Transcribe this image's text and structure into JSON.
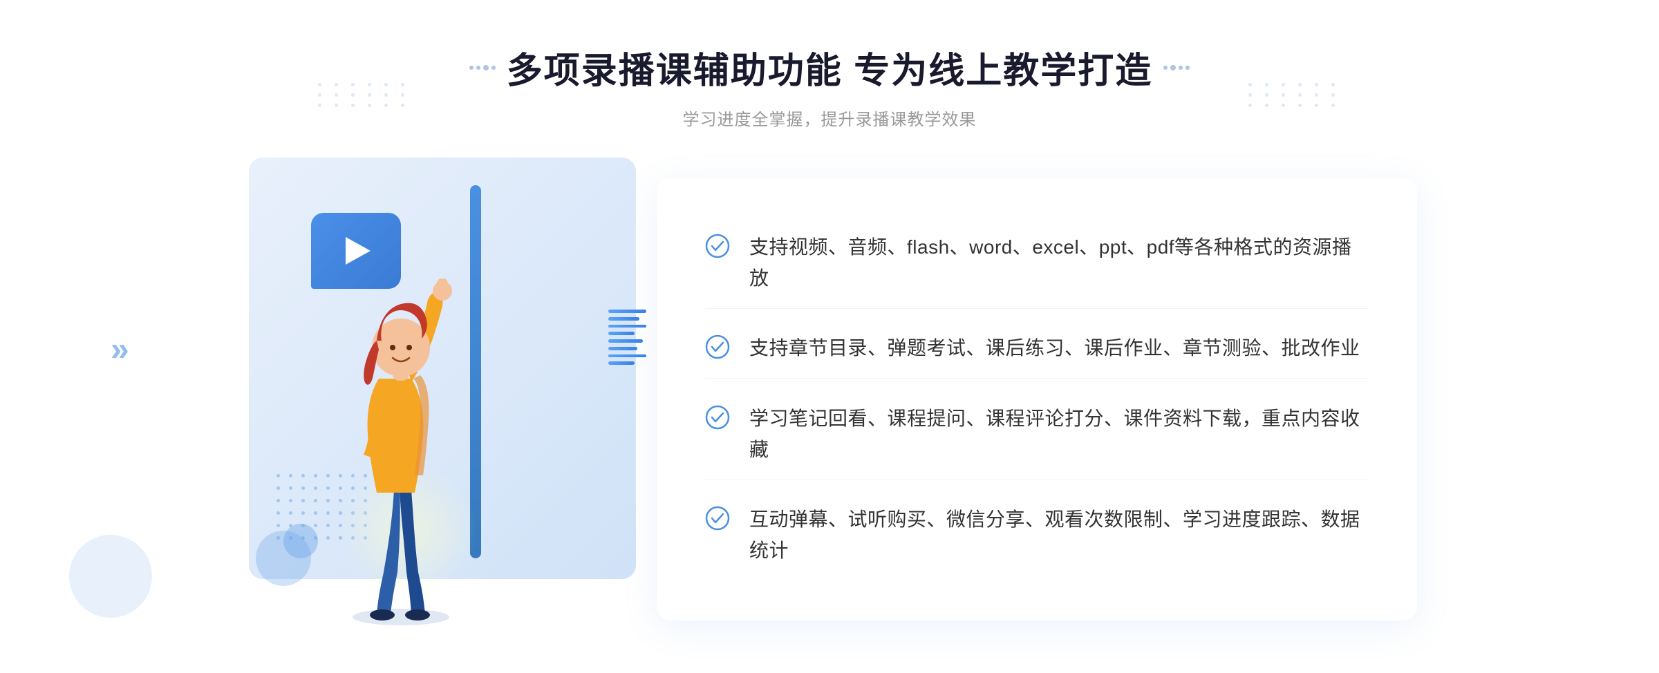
{
  "header": {
    "title": "多项录播课辅助功能 专为线上教学打造",
    "subtitle": "学习进度全掌握，提升录播课教学效果",
    "title_dots_left": "··",
    "title_dots_right": "··"
  },
  "features": [
    {
      "id": 1,
      "text": "支持视频、音频、flash、word、excel、ppt、pdf等各种格式的资源播放"
    },
    {
      "id": 2,
      "text": "支持章节目录、弹题考试、课后练习、课后作业、章节测验、批改作业"
    },
    {
      "id": 3,
      "text": "学习笔记回看、课程提问、课程评论打分、课件资料下载，重点内容收藏"
    },
    {
      "id": 4,
      "text": "互动弹幕、试听购买、微信分享、观看次数限制、学习进度跟踪、数据统计"
    }
  ],
  "colors": {
    "accent_blue": "#4a90e2",
    "light_blue": "#e8f0fb",
    "text_dark": "#1a1a2e",
    "text_gray": "#999999",
    "text_body": "#333333"
  },
  "chevron": "»"
}
